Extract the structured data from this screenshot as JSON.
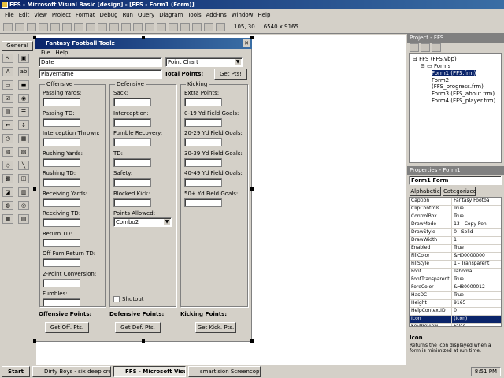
{
  "window": {
    "title": "FFS - Microsoft Visual Basic [design] - [FFS - Form1 (Form)]"
  },
  "menu": [
    "File",
    "Edit",
    "View",
    "Project",
    "Format",
    "Debug",
    "Run",
    "Query",
    "Diagram",
    "Tools",
    "Add-Ins",
    "Window",
    "Help"
  ],
  "toolbar": {
    "position": "105, 30",
    "size": "6540 x 9165"
  },
  "toolbox": {
    "tab": "General"
  },
  "form": {
    "title": "Fantasy Football Toolz",
    "menu": [
      "File",
      "Help"
    ],
    "date_value": "Date",
    "player_value": "Playername",
    "chart_select": "Point Chart",
    "total_label": "Total Points:",
    "get_pts": "Get Pts!",
    "offensive": {
      "title": "Offensive",
      "fields": [
        "Passing Yards:",
        "Passing TD:",
        "Interception Thrown:",
        "Rushing Yards:",
        "Rushing TD:",
        "Receiving Yards:",
        "Receiving TD:",
        "Return TD:",
        "Off Fum Return TD:",
        "2-Point Conversion:",
        "Fumbles:"
      ],
      "points_label": "Offensive Points:",
      "button": "Get Off. Pts."
    },
    "defensive": {
      "title": "Defensive",
      "fields": [
        "Sack:",
        "Interception:",
        "Fumble Recovery:",
        "TD:",
        "Safety:",
        "Blocked Kick:"
      ],
      "allowed_label": "Points Allowed:",
      "combo": "Combo2",
      "shutout": "Shutout",
      "points_label": "Defensive Points:",
      "button": "Get Def. Pts."
    },
    "kicking": {
      "title": "Kicking",
      "fields": [
        "Extra Points:",
        "0-19 Yd Field Goals:",
        "20-29 Yd Field Goals:",
        "30-39 Yd Field Goals:",
        "40-49 Yd Field Goals:",
        "50+ Yd Field Goals:"
      ],
      "points_label": "Kicking Points:",
      "button": "Get Kick. Pts."
    }
  },
  "project": {
    "title": "Project - FFS",
    "root": "FFS (FFS.vbp)",
    "folder": "Forms",
    "items": [
      "Form1 (FFS.frm)",
      "Form2 (FFS_progress.frm)",
      "Form3 (FFS_about.frm)",
      "Form4 (FFS_player.frm)"
    ]
  },
  "properties": {
    "title": "Properties - Form1",
    "object": "Form1 Form",
    "tabs": [
      "Alphabetic",
      "Categorized"
    ],
    "rows": [
      [
        "Caption",
        "Fantasy Footba"
      ],
      [
        "ClipControls",
        "True"
      ],
      [
        "ControlBox",
        "True"
      ],
      [
        "DrawMode",
        "13 - Copy Pen"
      ],
      [
        "DrawStyle",
        "0 - Solid"
      ],
      [
        "DrawWidth",
        "1"
      ],
      [
        "Enabled",
        "True"
      ],
      [
        "FillColor",
        "&H00000000"
      ],
      [
        "FillStyle",
        "1 - Transparent"
      ],
      [
        "Font",
        "Tahoma"
      ],
      [
        "FontTransparent",
        "True"
      ],
      [
        "ForeColor",
        "&H80000012"
      ],
      [
        "HasDC",
        "True"
      ],
      [
        "Height",
        "9165"
      ],
      [
        "HelpContextID",
        "0"
      ],
      [
        "Icon",
        "(Icon)"
      ],
      [
        "KeyPreview",
        "False"
      ]
    ],
    "desc_title": "Icon",
    "desc": "Returns the icon displayed when a form is minimized at run time."
  },
  "taskbar": {
    "start": "Start",
    "tasks": [
      "Dirty Boys - six deep cre...",
      "FFS - Microsoft Visual ...",
      "smartision Screencopy"
    ],
    "clock": "8:51 PM"
  }
}
